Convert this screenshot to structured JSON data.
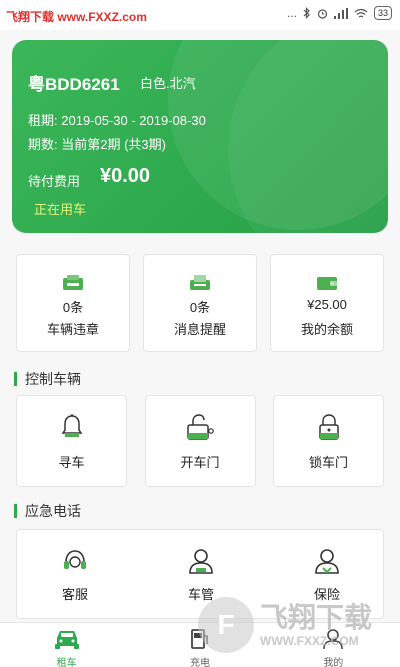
{
  "status_bar": {
    "watermark_left": "飞翔下载 www.FXXZ.com",
    "signal": "...",
    "battery": "33"
  },
  "rental": {
    "plate": "粤BDD6261",
    "car_desc": "白色.北汽",
    "period_label": "租期:",
    "period_value": "2019-05-30 - 2019-08-30",
    "phase_label": "期数:",
    "phase_value": "当前第2期 (共3期)",
    "due_label": "待付费用",
    "due_amount": "¥0.00",
    "status": "正在用车"
  },
  "stats": [
    {
      "value": "0条",
      "label": "车辆违章",
      "icon": "violation-card-icon"
    },
    {
      "value": "0条",
      "label": "消息提醒",
      "icon": "message-printer-icon"
    },
    {
      "value": "¥25.00",
      "label": "我的余额",
      "icon": "wallet-icon"
    }
  ],
  "control": {
    "title": "控制车辆",
    "items": [
      {
        "label": "寻车",
        "icon": "bell-icon"
      },
      {
        "label": "开车门",
        "icon": "unlock-icon"
      },
      {
        "label": "锁车门",
        "icon": "lock-icon"
      }
    ]
  },
  "emergency": {
    "title": "应急电话",
    "items": [
      {
        "label": "客服",
        "icon": "headset-icon"
      },
      {
        "label": "车管",
        "icon": "user-icon"
      },
      {
        "label": "保险",
        "icon": "insurance-user-icon"
      }
    ]
  },
  "tabs": [
    {
      "label": "租车",
      "icon": "car-icon",
      "active": true
    },
    {
      "label": "充电",
      "icon": "charge-icon",
      "active": false
    },
    {
      "label": "我的",
      "icon": "profile-icon",
      "active": false
    }
  ],
  "watermark": {
    "logo": "F",
    "text_big": "飞翔下载",
    "text_small": "WWW.FXXZ.COM"
  },
  "colors": {
    "accent": "#2ea94d",
    "in_use": "#e9f57a"
  }
}
